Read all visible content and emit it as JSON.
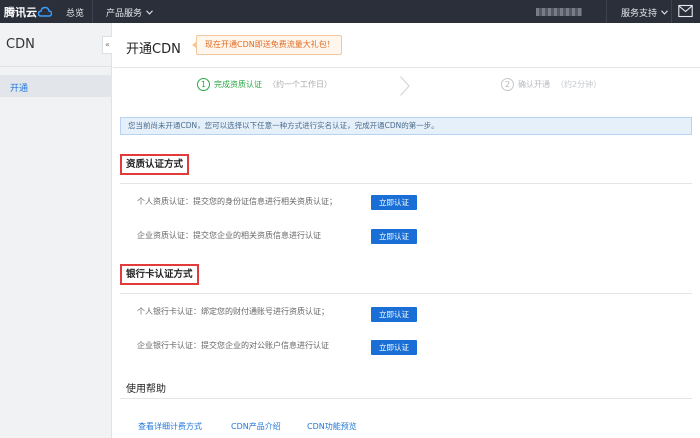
{
  "topbar": {
    "logo_text": "腾讯云",
    "nav_overview": "总览",
    "nav_products": "产品服务",
    "nav_support": "服务支持"
  },
  "sidebar": {
    "title": "CDN",
    "collapse_glyph": "«",
    "items": [
      {
        "label": "开通",
        "active": true
      }
    ]
  },
  "main": {
    "title": "开通CDN",
    "promo": "现在开通CDN即送免费流量大礼包！",
    "steps": [
      {
        "num": "1",
        "label": "完成资质认证",
        "sub": "（约一个工作日）",
        "state": "active"
      },
      {
        "num": "2",
        "label": "确认开通",
        "sub": "（约2分钟）",
        "state": "pending"
      }
    ],
    "info": "您当前尚未开通CDN，您可以选择以下任意一种方式进行实名认证，完成开通CDN的第一步。",
    "sections": [
      {
        "title": "资质认证方式",
        "rows": [
          {
            "label": "个人资质认证：提交您的身份证信息进行相关资质认证；",
            "button": "立即认证"
          },
          {
            "label": "企业资质认证：提交您企业的相关资质信息进行认证",
            "button": "立即认证"
          }
        ]
      },
      {
        "title": "银行卡认证方式",
        "rows": [
          {
            "label": "个人银行卡认证：绑定您的财付通账号进行资质认证；",
            "button": "立即认证"
          },
          {
            "label": "企业银行卡认证：提交您企业的对公账户信息进行认证",
            "button": "立即认证"
          }
        ]
      }
    ],
    "help": {
      "title": "使用帮助",
      "links": [
        "查看详细计费方式",
        "CDN产品介绍",
        "CDN功能预览"
      ]
    }
  },
  "colors": {
    "topbar_bg": "#2b2f3a",
    "accent_blue": "#1a6fd6",
    "step_green": "#2aa844",
    "highlight_red": "#e23b3b",
    "promo_orange": "#e06b1f"
  },
  "icons": [
    "cloud-logo-icon",
    "chevron-down-icon",
    "mail-icon",
    "step-arrow-icon"
  ]
}
